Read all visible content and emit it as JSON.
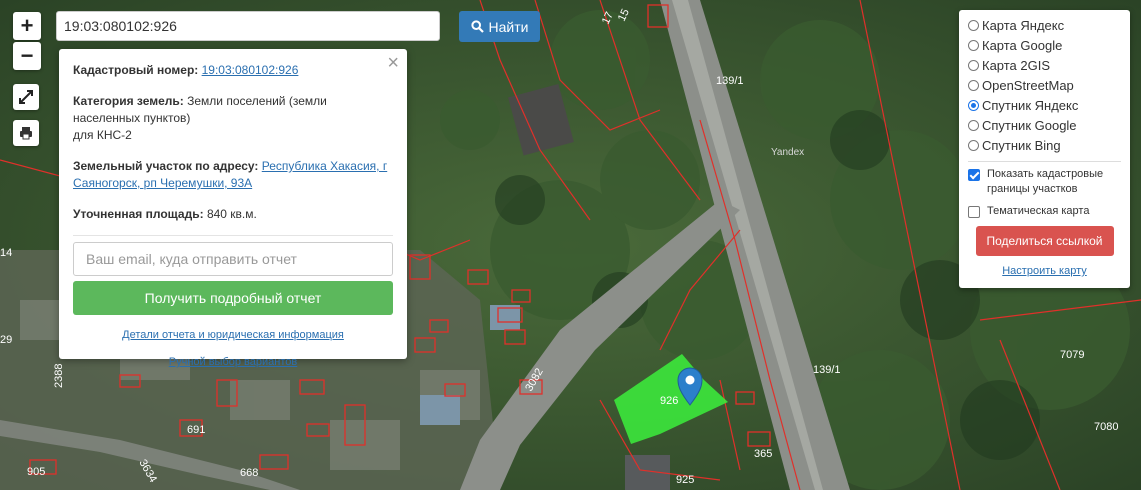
{
  "search": {
    "value": "19:03:080102:926",
    "button_label": "Найти"
  },
  "controls": {
    "zoom_in": "+",
    "zoom_out": "−",
    "fullscreen_icon": "expand-icon",
    "print_icon": "printer-icon"
  },
  "popup": {
    "close_glyph": "×",
    "cadastral_label": "Кадастровый номер:",
    "cadastral_value": "19:03:080102:926",
    "category_label": "Категория земель:",
    "category_value": "Земли поселений (земли населенных пунктов)",
    "category_use": "для КНС-2",
    "address_label": "Земельный участок по адресу:",
    "address_value": "Республика Хакасия, г Саяногорск, рп Черемушки, 93А",
    "area_label": "Уточненная площадь:",
    "area_value": "840 кв.м.",
    "email_placeholder": "Ваш email, куда отправить отчет",
    "report_button": "Получить подробный отчет",
    "details_link": "Детали отчета и юридическая информация",
    "manual_link": "Ручной выбор вариантов"
  },
  "layers": {
    "options": [
      {
        "label": "Карта Яндекс",
        "selected": false
      },
      {
        "label": "Карта Google",
        "selected": false
      },
      {
        "label": "Карта 2GIS",
        "selected": false
      },
      {
        "label": "OpenStreetMap",
        "selected": false
      },
      {
        "label": "Спутник Яндекс",
        "selected": true
      },
      {
        "label": "Спутник Google",
        "selected": false
      },
      {
        "label": "Спутник Bing",
        "selected": false
      }
    ],
    "show_borders_label": "Показать кадастровые границы участков",
    "show_borders_checked": true,
    "thematic_label": "Тематическая карта",
    "thematic_checked": false,
    "share_button": "Поделиться ссылкой",
    "setup_link": "Настроить карту"
  },
  "map": {
    "labels": [
      "139/1",
      "139/1",
      "3082",
      "926",
      "925",
      "365",
      "691",
      "668",
      "2388",
      "3634",
      "905",
      "14",
      "29",
      "7079",
      "7080",
      "17",
      "15"
    ],
    "watermark": "Yandex",
    "accent_colors": {
      "parcel_border": "#e0302a",
      "selected_parcel": "#3cf03c",
      "marker": "#2c7fcb"
    }
  }
}
